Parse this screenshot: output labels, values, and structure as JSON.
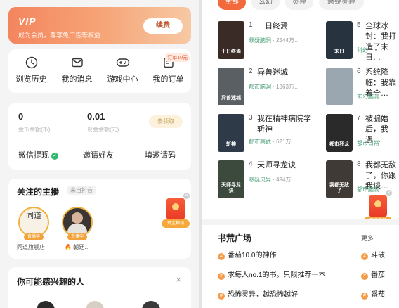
{
  "vip": {
    "logo": "VIP",
    "subtitle": "成为会员，尊享免广告等权益",
    "renew": "续费"
  },
  "quick": [
    {
      "label": "浏览历史",
      "icon": "clock-icon"
    },
    {
      "label": "我的消息",
      "icon": "message-icon"
    },
    {
      "label": "游戏中心",
      "icon": "gamepad-icon"
    },
    {
      "label": "我的订单",
      "icon": "order-icon",
      "badge": "订单10元"
    }
  ],
  "wallet": {
    "coins": "0",
    "coins_label": "金币余额(币)",
    "cash": "0.01",
    "cash_label": "现金余额(元)",
    "withdraw_btn": "去领取",
    "actions": [
      "微信提现",
      "邀请好友",
      "填邀请码"
    ]
  },
  "anchors": {
    "title": "关注的主播",
    "tag": "来自抖音",
    "items": [
      {
        "name": "同道旗舰店",
        "badge": "直播中",
        "glyph": "同道"
      },
      {
        "name": "🔥 朝廷…",
        "badge": "直播中"
      }
    ]
  },
  "redfloat": {
    "label": "开宝箱领",
    "close": "×"
  },
  "interest": {
    "title": "你可能感兴趣的人",
    "close": "×"
  },
  "tabs": [
    "全部",
    "玄幻",
    "灵异",
    "悬疑灵异"
  ],
  "books": [
    {
      "rank": "1",
      "title": "十日终焉",
      "genre": "悬疑脑洞",
      "count": "2544万…",
      "cover_text": "十日终焉",
      "cover_color": "#3a2b26"
    },
    {
      "rank": "2",
      "title": "异兽迷城",
      "genre": "都市脑洞",
      "count": "1363万…",
      "cover_text": "异兽迷城",
      "cover_color": "#5a5f63"
    },
    {
      "rank": "3",
      "title": "我在精神病院学斩神",
      "genre": "都市高武",
      "count": "621万…",
      "cover_text": "斩神",
      "cover_color": "#2f3a48"
    },
    {
      "rank": "4",
      "title": "天师寻龙诀",
      "genre": "悬疑灵异",
      "count": "494万…",
      "cover_text": "天师寻龙诀",
      "cover_color": "#3c4a3e"
    },
    {
      "rank": "5",
      "title": "全球冰封：我打造了末日…",
      "genre": "科幻",
      "count": "",
      "cover_text": "末日",
      "cover_color": "#27333f"
    },
    {
      "rank": "6",
      "title": "系统降临：我靠着全…",
      "genre": "玄幻脑洞",
      "count": "",
      "cover_text": "",
      "cover_color": "#9aa7b0"
    },
    {
      "rank": "7",
      "title": "被骗婚后，我遇…",
      "genre": "都市日常",
      "count": "",
      "cover_text": "都市狂龙",
      "cover_color": "#2b2a2a"
    },
    {
      "rank": "8",
      "title": "我都无敌了，你跟我谈…",
      "genre": "都市脑洞",
      "count": "",
      "cover_text": "我都无敌了",
      "cover_color": "#3f3a35"
    }
  ],
  "plaza": {
    "title": "书荒广场",
    "more": "更多",
    "topics": [
      "番茄10.0的神作",
      "求每人no.1的书。只限推荐一本",
      "恐怖灵异，越恐怖越好"
    ],
    "topics_right": [
      "斗破",
      "番茄",
      "番茄"
    ]
  }
}
